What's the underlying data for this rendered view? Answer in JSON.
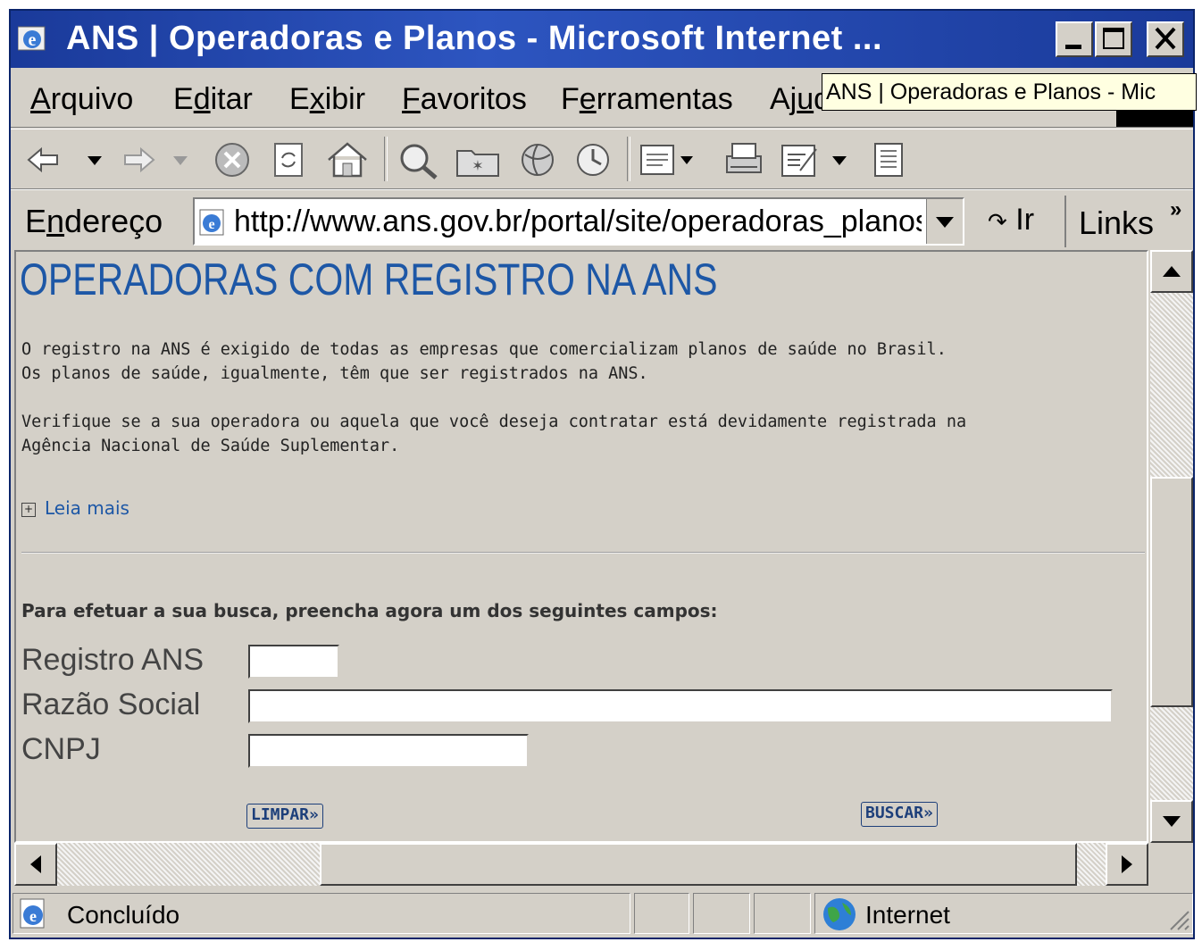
{
  "window": {
    "title": "ANS | Operadoras e Planos - Microsoft Internet ...",
    "tooltip": "ANS | Operadoras e Planos - Mic"
  },
  "menu": {
    "items": [
      {
        "label": "Arquivo",
        "u": "A",
        "rest": "rquivo"
      },
      {
        "label": "Editar",
        "u": "d",
        "pre": "E",
        "rest": "itar"
      },
      {
        "label": "Exibir",
        "u": "x",
        "pre": "E",
        "rest": "ibir"
      },
      {
        "label": "Favoritos",
        "u": "F",
        "rest": "avoritos"
      },
      {
        "label": "Ferramentas",
        "u": "e",
        "pre": "F",
        "rest": "rramentas"
      },
      {
        "label": "Ajuda",
        "pre": "Aj",
        "u": "u",
        "rest": "da"
      }
    ]
  },
  "address": {
    "label_pre": "E",
    "label_u": "n",
    "label_rest": "dereço",
    "url": "http://www.ans.gov.br/portal/site/operadoras_planos",
    "go_label": "Ir",
    "links_label": "Links",
    "links_chevron": "»"
  },
  "content": {
    "title": "OPERADORAS COM REGISTRO NA ANS",
    "para1_line1": "O registro na ANS é exigido de todas as empresas que comercializam planos de saúde no Brasil.",
    "para1_line2": "Os planos de saúde, igualmente, têm que ser registrados na ANS.",
    "para2_line1": "Verifique se a sua operadora ou aquela que você deseja contratar está devidamente registrada na",
    "para2_line2": "Agência Nacional de Saúde Suplementar.",
    "read_more": "Leia mais",
    "read_more_icon": "plus-box-icon",
    "instructions": "Para efetuar a sua busca, preencha agora um dos seguintes campos:",
    "fields": {
      "registro_label": "Registro ANS",
      "registro_value": "",
      "razao_label": "Razão Social",
      "razao_value": "",
      "cnpj_label": "CNPJ",
      "cnpj_value": ""
    },
    "buttons": {
      "clear": "LIMPAR»",
      "search": "BUSCAR»"
    }
  },
  "status": {
    "text": "Concluído",
    "zone": "Internet"
  },
  "colors": {
    "title_bar": "#2d55c0",
    "link_blue": "#1d57a6",
    "chrome": "#d4d0c8"
  }
}
